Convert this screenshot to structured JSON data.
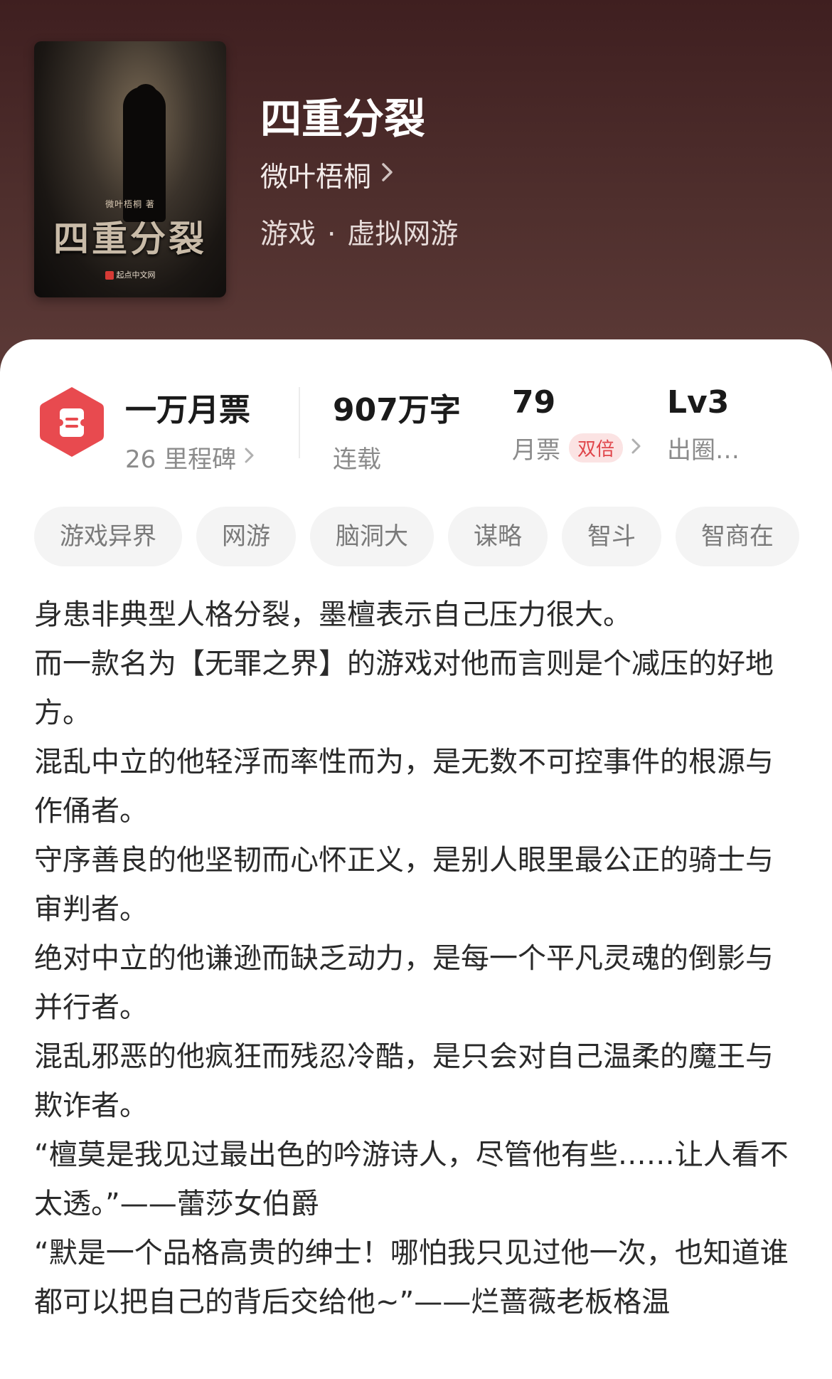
{
  "book": {
    "title": "四重分裂",
    "author": "微叶梧桐",
    "category": "游戏",
    "subcategory": "虚拟网游",
    "cover": {
      "title": "四重分裂",
      "author_line": "微叶梧桐 著",
      "publisher": "起点中文网"
    }
  },
  "stats": {
    "ticket": {
      "value": "一万月票",
      "label": "26 里程碑"
    },
    "words": {
      "value": "907万字",
      "label": "连载"
    },
    "monthly": {
      "value": "79",
      "label": "月票",
      "badge": "双倍"
    },
    "level": {
      "value": "Lv3",
      "label": "出圈…"
    }
  },
  "tags": [
    "游戏异界",
    "网游",
    "脑洞大",
    "谋略",
    "智斗",
    "智商在"
  ],
  "synopsis": [
    "身患非典型人格分裂，墨檀表示自己压力很大。",
    "而一款名为【无罪之界】的游戏对他而言则是个减压的好地方。",
    "混乱中立的他轻浮而率性而为，是无数不可控事件的根源与作俑者。",
    "守序善良的他坚韧而心怀正义，是别人眼里最公正的骑士与审判者。",
    "绝对中立的他谦逊而缺乏动力，是每一个平凡灵魂的倒影与并行者。",
    "混乱邪恶的他疯狂而残忍冷酷，是只会对自己温柔的魔王与欺诈者。",
    "“檀莫是我见过最出色的吟游诗人，尽管他有些……让人看不太透。”——蕾莎女伯爵",
    "“默是一个品格高贵的绅士！哪怕我只见过他一次，也知道谁都可以把自己的背后交给他~”——烂蔷薇老板格温"
  ],
  "colors": {
    "header_bg": "#4a2a29",
    "accent": "#e84a4f",
    "badge_bg": "#fbe3e3"
  },
  "icons": {
    "ticket": "ticket-hexagon-icon",
    "chevron": "chevron-right-icon"
  }
}
